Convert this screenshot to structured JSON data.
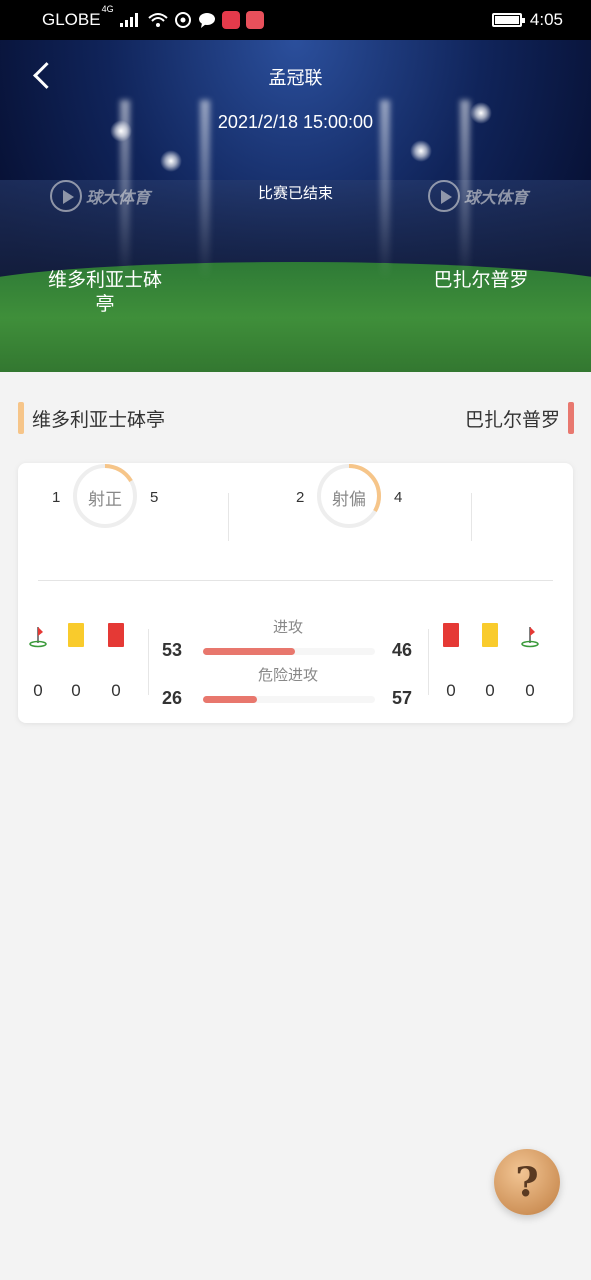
{
  "status_bar": {
    "carrier": "GLOBE",
    "network": "4G",
    "time": "4:05"
  },
  "header": {
    "league": "孟冠联",
    "datetime": "2021/2/18 15:00:00",
    "match_status": "比赛已结束",
    "home_team": "维多利亚士砵亭",
    "away_team": "巴扎尔普罗",
    "watermark": "球大体育"
  },
  "teams": {
    "home": "维多利亚士砵亭",
    "away": "巴扎尔普罗",
    "home_color": "#f6c589",
    "away_color": "#e8786f"
  },
  "shots": {
    "on_target": {
      "label": "射正",
      "home": "1",
      "away": "5",
      "home_share": 0.1667
    },
    "off_target": {
      "label": "射偏",
      "home": "2",
      "away": "4",
      "home_share": 0.3333
    }
  },
  "events": {
    "home": {
      "corners": "0",
      "yellow_cards": "0",
      "red_cards": "0"
    },
    "away": {
      "red_cards": "0",
      "yellow_cards": "0",
      "corners": "0"
    }
  },
  "attacks": {
    "attack": {
      "label": "进攻",
      "home": "53",
      "away": "46",
      "home_share": 0.535
    },
    "dangerous": {
      "label": "危险进攻",
      "home": "26",
      "away": "57",
      "home_share": 0.313
    }
  },
  "help_button": {
    "glyph": "?"
  },
  "colors": {
    "accent_bar": "#e8776d",
    "ring_accent": "#f6c589",
    "ring_base": "#eeeeee",
    "yellow_card": "#f9cb2c",
    "red_card": "#e53935"
  }
}
